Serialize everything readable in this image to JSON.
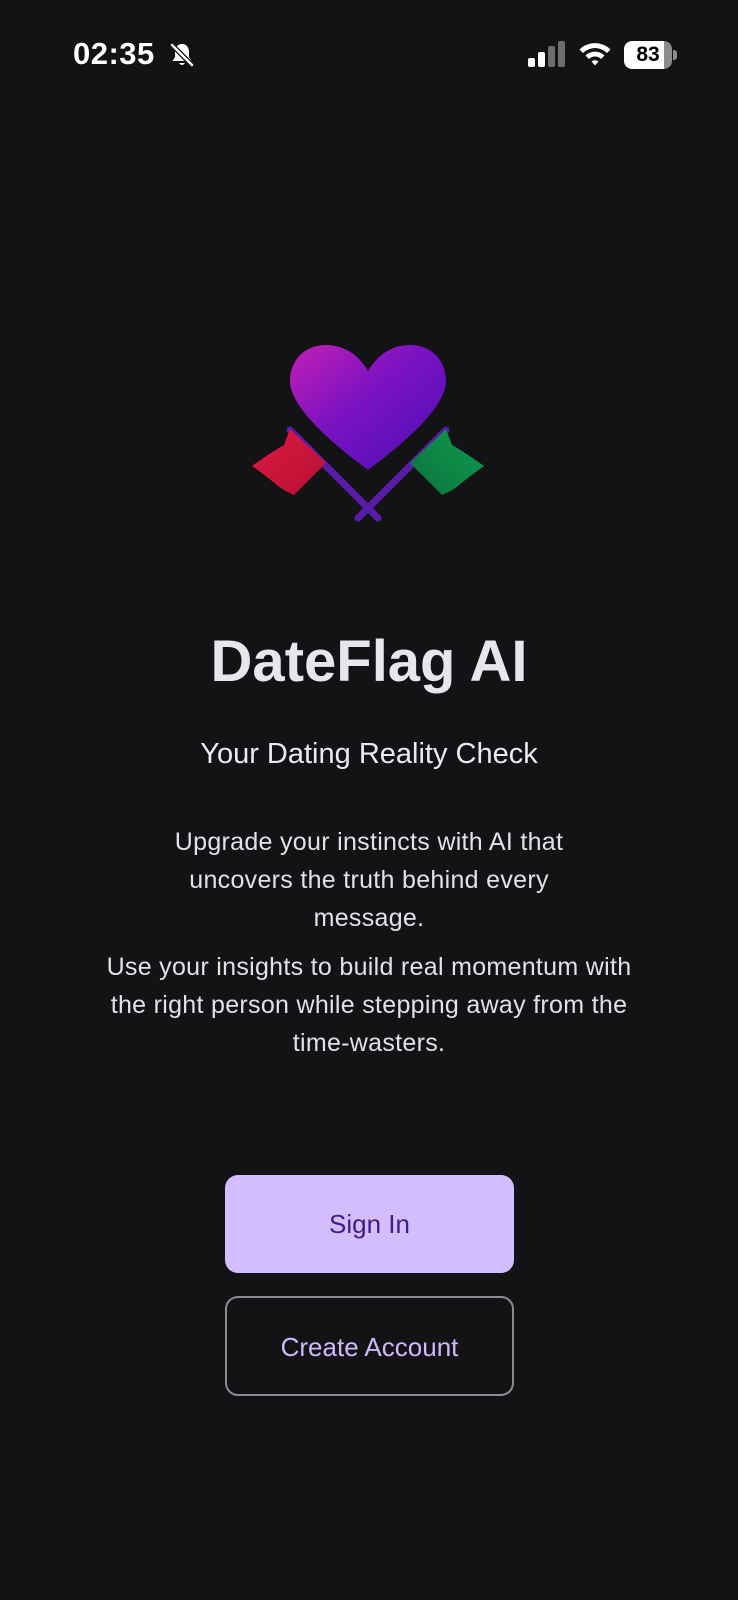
{
  "status_bar": {
    "time": "02:35",
    "battery_level": "83",
    "battery_fraction": 0.83,
    "icons": [
      "bell-slash-icon",
      "cellular-signal-icon",
      "wifi-icon",
      "battery-icon"
    ]
  },
  "logo": {
    "icon": "heart-with-crossed-flags-logo",
    "colors": {
      "heart_start": "#c21fb4",
      "heart_end": "#4a0fb5",
      "red_flag": "#d8173f",
      "green_flag": "#0e8a48",
      "poles": "#5a1aa8"
    }
  },
  "app": {
    "title": "DateFlag AI",
    "tagline": "Your Dating Reality Check",
    "description_1": "Upgrade your instincts with AI that uncovers the truth behind every message.",
    "description_2": "Use your insights to build real momentum with the right person while stepping away from the time-wasters."
  },
  "actions": {
    "sign_in_label": "Sign In",
    "create_account_label": "Create Account"
  },
  "colors": {
    "background": "#131215",
    "primary_button": "#d4bdfc",
    "primary_button_text": "#3f1d83",
    "secondary_button_text": "#cfb8fb"
  }
}
